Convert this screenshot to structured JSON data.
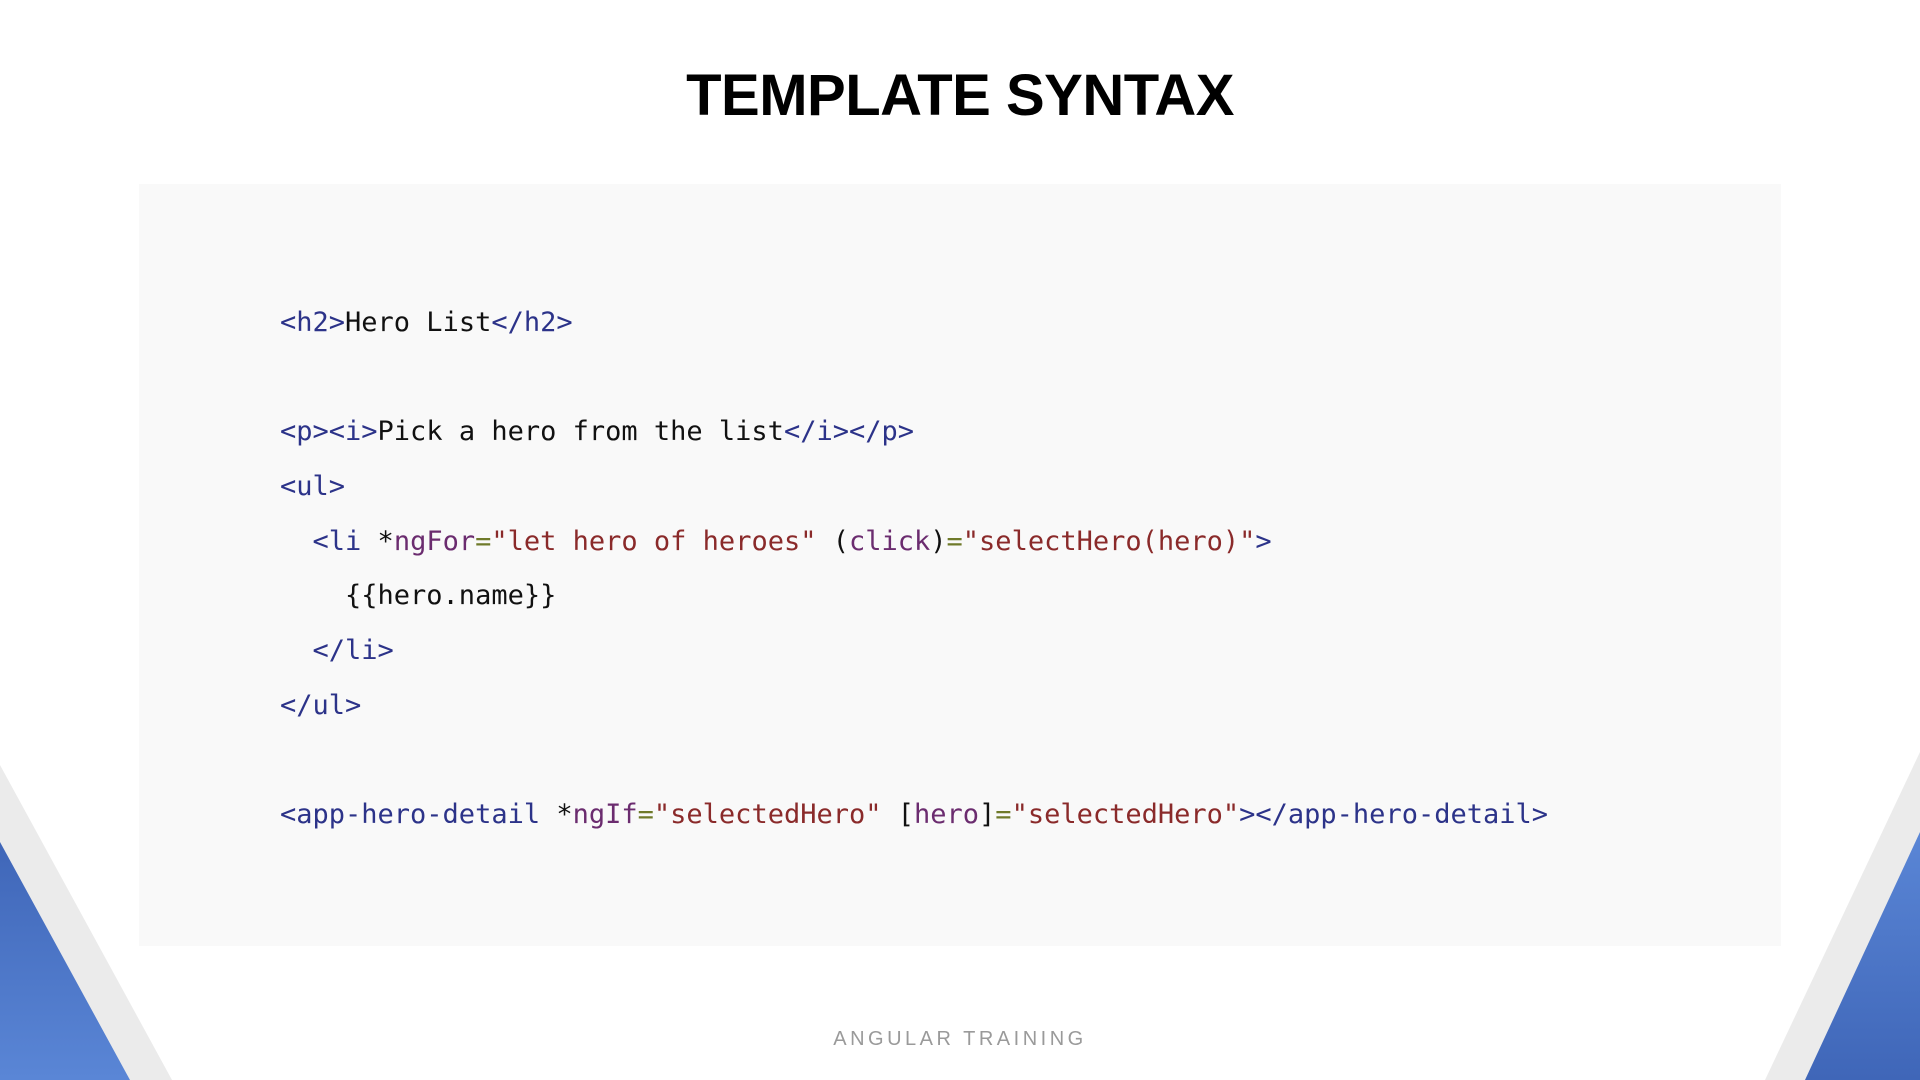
{
  "slide": {
    "title": "TEMPLATE SYNTAX",
    "footer": "ANGULAR TRAINING"
  },
  "code": {
    "lines": [
      [
        {
          "t": "tag",
          "v": "<h2>"
        },
        {
          "t": "txt",
          "v": "Hero List"
        },
        {
          "t": "tag",
          "v": "</h2>"
        }
      ],
      [],
      [
        {
          "t": "tag",
          "v": "<p><i>"
        },
        {
          "t": "txt",
          "v": "Pick a hero from the list"
        },
        {
          "t": "tag",
          "v": "</i></p>"
        }
      ],
      [
        {
          "t": "tag",
          "v": "<ul>"
        }
      ],
      [
        {
          "t": "txt",
          "v": "  "
        },
        {
          "t": "tag",
          "v": "<li"
        },
        {
          "t": "txt",
          "v": " *"
        },
        {
          "t": "attr",
          "v": "ngFor"
        },
        {
          "t": "eq",
          "v": "="
        },
        {
          "t": "str",
          "v": "\"let hero of heroes\""
        },
        {
          "t": "txt",
          "v": " ("
        },
        {
          "t": "attr",
          "v": "click"
        },
        {
          "t": "txt",
          "v": ")"
        },
        {
          "t": "eq",
          "v": "="
        },
        {
          "t": "str",
          "v": "\"selectHero(hero)\""
        },
        {
          "t": "tag",
          "v": ">"
        }
      ],
      [
        {
          "t": "txt",
          "v": "    {{hero.name}}"
        }
      ],
      [
        {
          "t": "txt",
          "v": "  "
        },
        {
          "t": "tag",
          "v": "</li>"
        }
      ],
      [
        {
          "t": "tag",
          "v": "</ul>"
        }
      ],
      [],
      [
        {
          "t": "tag",
          "v": "<app-hero-detail"
        },
        {
          "t": "txt",
          "v": " *"
        },
        {
          "t": "attr",
          "v": "ngIf"
        },
        {
          "t": "eq",
          "v": "="
        },
        {
          "t": "str",
          "v": "\"selectedHero\""
        },
        {
          "t": "txt",
          "v": " ["
        },
        {
          "t": "attr",
          "v": "hero"
        },
        {
          "t": "txt",
          "v": "]"
        },
        {
          "t": "eq",
          "v": "="
        },
        {
          "t": "str",
          "v": "\"selectedHero\""
        },
        {
          "t": "tag",
          "v": "></app-hero-detail>"
        }
      ]
    ]
  },
  "colors": {
    "tag": "#2c3389",
    "attribute": "#6b2c6f",
    "equals": "#6f7a2a",
    "string": "#8a2a2a",
    "text": "#111111",
    "accent_blue": "#4a73c4",
    "decor_gray": "#ebebeb"
  }
}
